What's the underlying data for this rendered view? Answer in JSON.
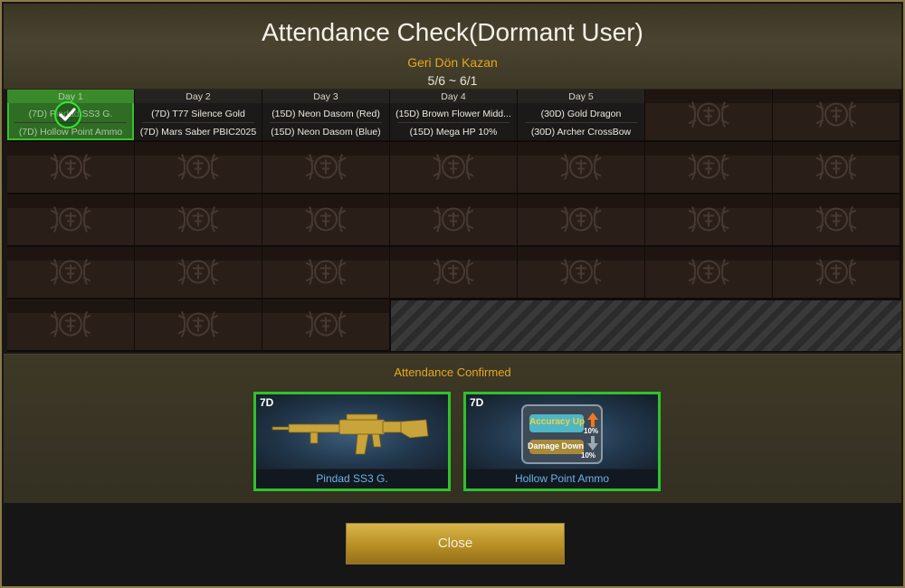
{
  "dialog": {
    "title": "Attendance Check(Dormant User)",
    "subtitle": "Geri Dön Kazan",
    "date_range": "5/6 ~ 6/1"
  },
  "calendar": {
    "days": [
      {
        "label": "Day 1",
        "item1": "(7D) Pindad SS3 G.",
        "item2": "(7D) Hollow Point Ammo",
        "checked": true
      },
      {
        "label": "Day 2",
        "item1": "(7D) T77 Silence Gold",
        "item2": "(7D) Mars Saber PBIC2025",
        "checked": false
      },
      {
        "label": "Day 3",
        "item1": "(15D) Neon Dasom (Red)",
        "item2": "(15D) Neon Dasom (Blue)",
        "checked": false
      },
      {
        "label": "Day 4",
        "item1": "(15D) Brown Flower Midd...",
        "item2": "(15D) Mega HP 10%",
        "checked": false
      },
      {
        "label": "Day 5",
        "item1": "(30D) Gold Dragon",
        "item2": "(30D) Archer CrossBow",
        "checked": false
      }
    ]
  },
  "confirmation": {
    "label": "Attendance Confirmed",
    "rewards": [
      {
        "duration": "7D",
        "name": "Pindad SS3 G.",
        "icon": "rifle-icon"
      },
      {
        "duration": "7D",
        "name": "Hollow Point Ammo",
        "icon": "ammo-card-icon",
        "card_line1": "Accuracy Up",
        "card_pct1": "10%",
        "card_line2": "Damage Down",
        "card_pct2": "10%"
      }
    ]
  },
  "footer": {
    "close_label": "Close"
  },
  "colors": {
    "accent_gold": "#e6a81c",
    "check_green": "#2eea33",
    "reward_name_blue": "#6ab4e6"
  }
}
